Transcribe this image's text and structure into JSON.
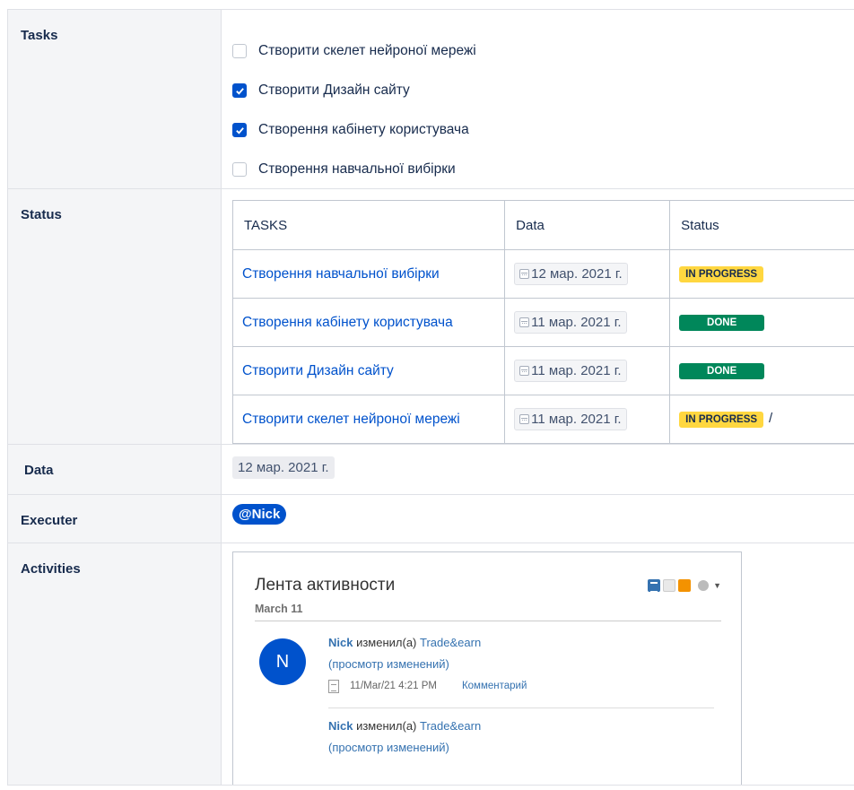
{
  "labels": {
    "tasks": "Tasks",
    "status": "Status",
    "data": "Data",
    "executer": "Executer",
    "activities": "Activities"
  },
  "tasks": [
    {
      "label": "Створити скелет нейроної мережі",
      "checked": false
    },
    {
      "label": "Створити Дизайн сайту",
      "checked": true
    },
    {
      "label": "Створення кабінету користувача",
      "checked": true
    },
    {
      "label": "Створення навчальної вибірки",
      "checked": false
    }
  ],
  "status_table": {
    "headers": [
      "TASKS",
      "Data",
      "Status"
    ],
    "rows": [
      {
        "task": "Створення навчальної вибірки",
        "date": "12 мар. 2021 г.",
        "status": "IN PROGRESS",
        "suffix": ""
      },
      {
        "task": "Створення кабінету користувача",
        "date": "11 мар. 2021 г.",
        "status": "DONE",
        "suffix": ""
      },
      {
        "task": "Створити Дизайн сайту",
        "date": "11 мар. 2021 г.",
        "status": "DONE",
        "suffix": ""
      },
      {
        "task": "Створити скелет нейроної мережі",
        "date": "11 мар. 2021 г.",
        "status": "IN PROGRESS",
        "suffix": "/"
      }
    ]
  },
  "date_value": "12 мар. 2021 г.",
  "executer": "@Nick",
  "activity": {
    "title": "Лента активности",
    "date_group": "March 11",
    "avatar_letter": "N",
    "entries": [
      {
        "user": "Nick",
        "action": " изменил(а) ",
        "page": "Trade&earn",
        "view_changes": "(просмотр изменений)",
        "time": "11/Mar/21 4:21 PM",
        "comment": "Комментарий"
      },
      {
        "user": "Nick",
        "action": " изменил(а) ",
        "page": "Trade&earn",
        "view_changes": "(просмотр изменений)"
      }
    ]
  },
  "colors": {
    "accent": "#0052cc",
    "done": "#00875a",
    "in_progress": "#ffd740"
  }
}
